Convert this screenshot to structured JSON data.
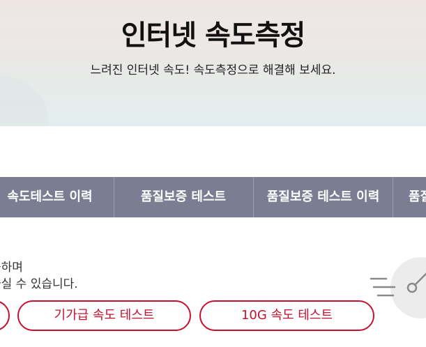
{
  "hero": {
    "title": "인터넷 속도측정",
    "subtitle": "느려진 인터넷 속도! 속도측정으로 해결해 보세요."
  },
  "tabs": [
    {
      "label": "속도테스트 이력"
    },
    {
      "label": "품질보증 테스트"
    },
    {
      "label": "품질보증 테스트 이력"
    },
    {
      "label": "품질"
    }
  ],
  "description": {
    "line1": "능하며",
    "line2": "하실 수 있습니다."
  },
  "buttons": [
    {
      "label": "기가급 속도 테스트"
    },
    {
      "label": "10G 속도 테스트"
    }
  ],
  "colors": {
    "accent": "#c8102e",
    "tabbar": "#7b7d92"
  },
  "icons": [
    "speedometer-icon"
  ]
}
